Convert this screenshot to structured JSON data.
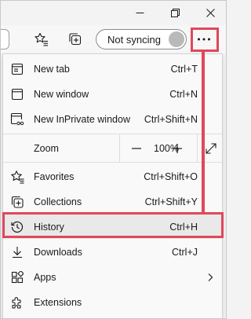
{
  "sync": {
    "label": "Not syncing"
  },
  "menu": {
    "items": [
      {
        "label": "New tab",
        "shortcut": "Ctrl+T",
        "icon": "new-tab-icon"
      },
      {
        "label": "New window",
        "shortcut": "Ctrl+N",
        "icon": "new-window-icon"
      },
      {
        "label": "New InPrivate window",
        "shortcut": "Ctrl+Shift+N",
        "icon": "inprivate-icon"
      },
      {
        "label": "Favorites",
        "shortcut": "Ctrl+Shift+O",
        "icon": "favorites-icon"
      },
      {
        "label": "Collections",
        "shortcut": "Ctrl+Shift+Y",
        "icon": "collections-icon"
      },
      {
        "label": "History",
        "shortcut": "Ctrl+H",
        "icon": "history-icon"
      },
      {
        "label": "Downloads",
        "shortcut": "Ctrl+J",
        "icon": "downloads-icon"
      },
      {
        "label": "Apps",
        "shortcut": "",
        "icon": "apps-icon"
      },
      {
        "label": "Extensions",
        "shortcut": "",
        "icon": "extensions-icon"
      }
    ],
    "zoom": {
      "label": "Zoom",
      "value": "100%",
      "minus": "—",
      "plus": "+"
    }
  },
  "colors": {
    "highlight": "#e0485a"
  }
}
